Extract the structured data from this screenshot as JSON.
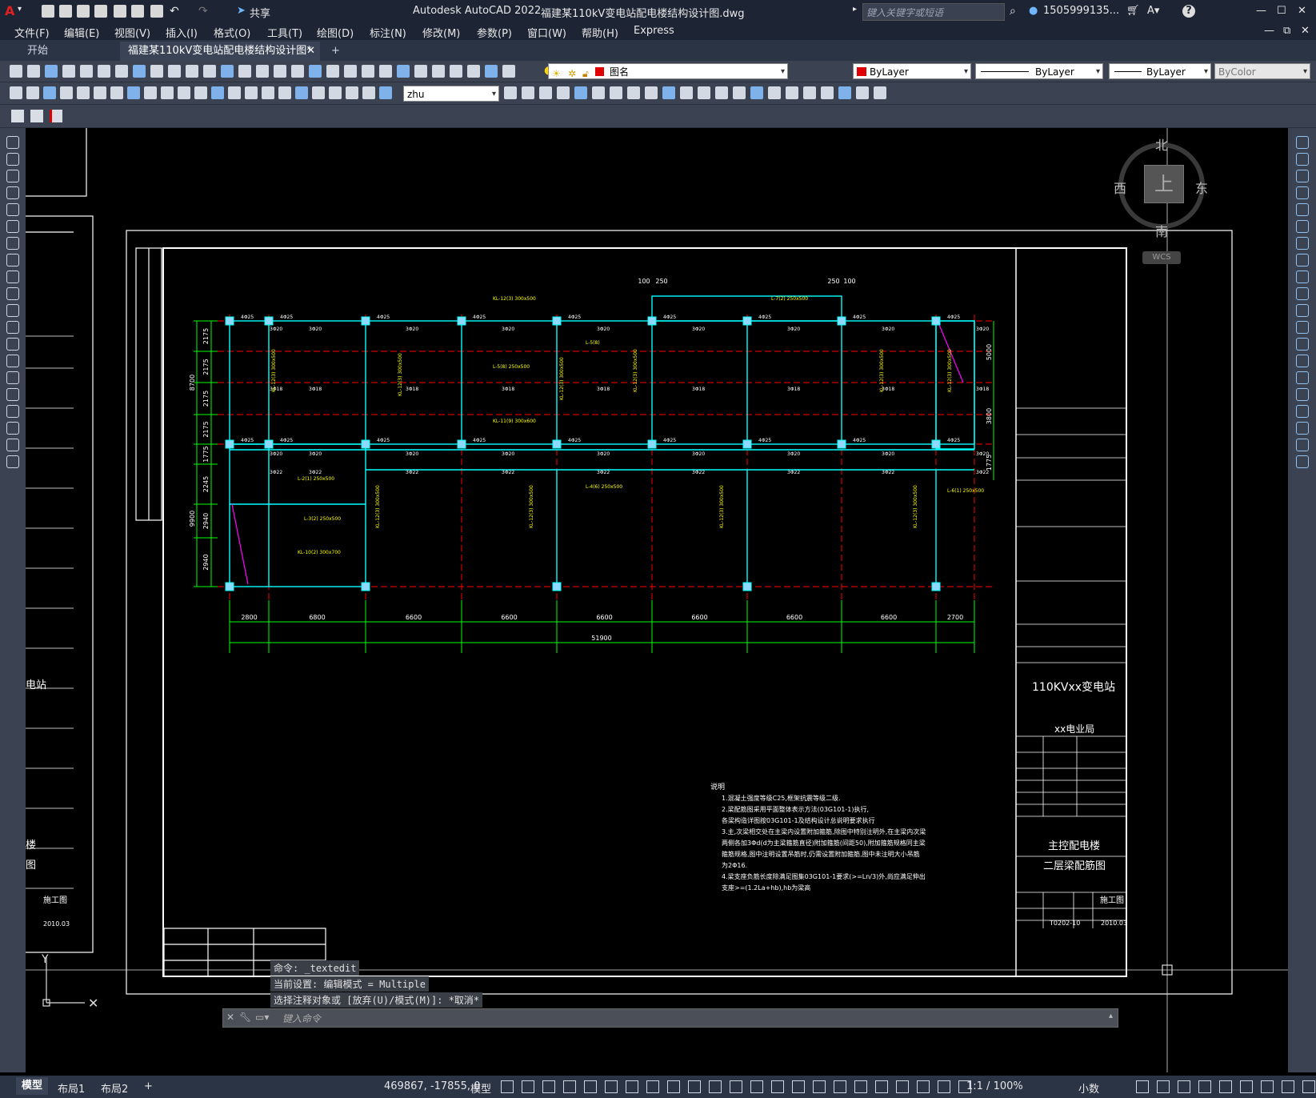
{
  "app": {
    "title": "Autodesk AutoCAD 2022",
    "file_name": "福建某110kV变电站配电楼结构设计图.dwg",
    "share_label": "共享",
    "search_placeholder": "键入关键字或短语",
    "user_name": "1505999135...",
    "help_icon": "help-icon"
  },
  "menu": {
    "items": [
      "文件(F)",
      "编辑(E)",
      "视图(V)",
      "插入(I)",
      "格式(O)",
      "工具(T)",
      "绘图(D)",
      "标注(N)",
      "修改(M)",
      "参数(P)",
      "窗口(W)",
      "帮助(H)",
      "Express"
    ]
  },
  "tabs": {
    "start": "开始",
    "active": "福建某110kV变电站配电楼结构设计图*",
    "add": "+"
  },
  "toolbar": {
    "layer_name": "图名",
    "color": "ByLayer",
    "linetype": "ByLayer",
    "lineweight": "ByLayer",
    "plotstyle": "ByColor",
    "dimstyle": "zhu"
  },
  "viewcube": {
    "north": "北",
    "south": "南",
    "east": "东",
    "west": "西",
    "top": "上",
    "wcs": "WCS"
  },
  "drawing": {
    "project_title": "110KVxx变电站",
    "owner": "xx电业局",
    "sheet_title_1": "主控配电楼",
    "sheet_title_2": "二层梁配筋图",
    "sheet_no": "T0202-10",
    "date": "2010.03",
    "stage": "施工图",
    "left_fragment_1": "电站",
    "left_fragment_2": "楼",
    "left_fragment_3": "图",
    "notes_heading": "说明",
    "notes": [
      "1.混凝土强度等级C25,框架抗震等级二级.",
      "2.梁配筋图采用平面整体表示方法(03G101-1)执行,",
      "各梁构造详图按03G101-1及结构设计总说明要求执行",
      "3.主,次梁相交处在主梁内设置附加箍筋,除图中特别注明外,在主梁内次梁",
      "两侧各加3Φd(d为主梁箍筋直径)附加箍筋(间距50),附加箍筋规格同主梁",
      "箍筋规格,图中注明设置吊筋时,仍需设置附加箍筋,图中未注明大小吊筋",
      "为2Φ16.",
      "4.梁支座负筋长度除满足图集03G101-1要求(>=Ln/3)外,尚应满足伸出",
      "支座>=(1.2La+hb),hb为梁高"
    ],
    "dims_bottom": [
      "2800",
      "6800",
      "6600",
      "6600",
      "6600",
      "6600",
      "6600",
      "6600",
      "2700"
    ],
    "total_dim": "51900",
    "dims_left": [
      "2175",
      "2175",
      "2175",
      "2175",
      "1775",
      "2245",
      "2940",
      "2940"
    ],
    "left_total_1": "8700",
    "left_total_2": "9900",
    "right_dims": [
      "5000",
      "3800",
      "1775"
    ],
    "top_dims": [
      "100",
      "250",
      "250",
      "100"
    ],
    "grid_labels": [
      "4Φ25",
      "3Φ20",
      "3Φ18",
      "3Φ22"
    ],
    "beam_labels": [
      "KL-12(3) 300x500",
      "L-5(8)",
      "L-5(8) 250x500",
      "KL-11(9) 300x600",
      "L-4(6) 250x500",
      "L-2(1) 250x500",
      "L-3(2) 250x500",
      "KL-10(2) 300x700",
      "L-7(2) 250x500",
      "L-6(1) 250x500"
    ]
  },
  "command": {
    "line1": "命令: _textedit",
    "line2": "当前设置: 编辑模式 = Multiple",
    "line3": "选择注释对象或 [放弃(U)/模式(M)]: *取消*",
    "placeholder": "键入命令"
  },
  "status": {
    "layout_tabs": [
      "模型",
      "布局1",
      "布局2"
    ],
    "add_layout": "+",
    "coords": "469867, -17855, 0",
    "space": "模型",
    "scale": "1:1 / 100%",
    "units": "小数"
  },
  "colors": {
    "titlebar": "#1d2433",
    "toolbar": "#3b4352",
    "green_dim": "#00ff00",
    "red_axis": "#ff0000",
    "cyan_beam": "#00ffff",
    "yellow_text": "#ffff00",
    "white_line": "#ffffff"
  }
}
